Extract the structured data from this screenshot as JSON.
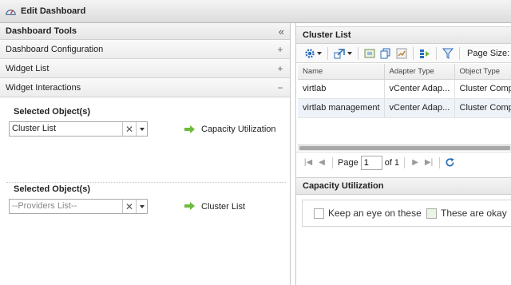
{
  "window": {
    "title": "Edit Dashboard",
    "logo_icon": "dashboard-gauge-icon"
  },
  "left_panel": {
    "header": {
      "label": "Dashboard Tools",
      "collapse_icon": "«"
    },
    "sections": [
      {
        "label": "Dashboard Configuration",
        "sign": "+"
      },
      {
        "label": "Widget List",
        "sign": "+"
      },
      {
        "label": "Widget Interactions",
        "sign": "−"
      }
    ],
    "interactions": [
      {
        "label": "Selected Object(s)",
        "value": "Cluster List",
        "placeholder": false,
        "target": "Capacity Utilization"
      },
      {
        "label": "Selected Object(s)",
        "value": "--Providers List--",
        "placeholder": true,
        "target": "Cluster List"
      }
    ]
  },
  "cluster_list": {
    "title": "Cluster List",
    "page_size_label": "Page Size:",
    "columns": [
      "Name",
      "Adapter Type",
      "Object Type"
    ],
    "rows": [
      [
        "virtlab",
        "vCenter Adap...",
        "Cluster Comp..."
      ],
      [
        "virtlab management",
        "vCenter Adap...",
        "Cluster Comp..."
      ]
    ],
    "pager": {
      "page_label": "Page",
      "page_value": "1",
      "of_label": "of 1"
    }
  },
  "capacity": {
    "title": "Capacity Utilization",
    "legend": [
      {
        "label": "Keep an eye on these",
        "color": "#ffffff"
      },
      {
        "label": "These are okay",
        "color": "#eaf5e4"
      }
    ]
  },
  "colors": {
    "arrow_green": "#6dbb3c",
    "gear_blue": "#2a6db8"
  }
}
